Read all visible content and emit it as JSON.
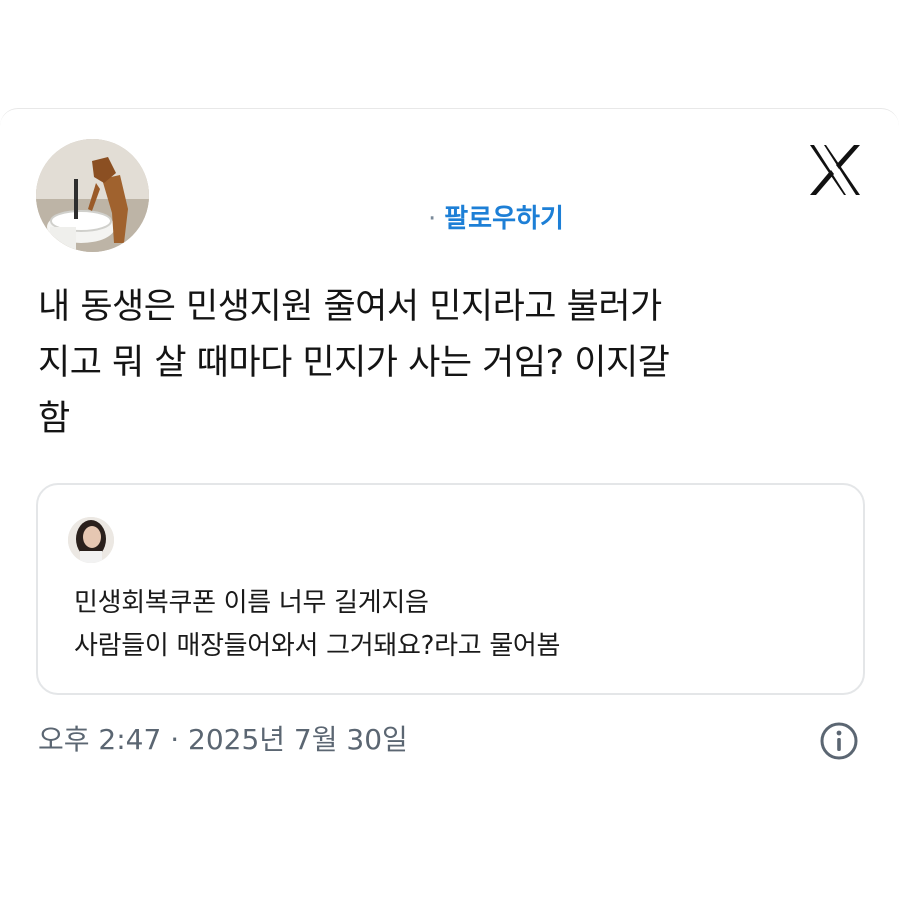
{
  "header": {
    "follow_dot": "·",
    "follow_label": "팔로우하기",
    "accent_color": "#1d7fd6"
  },
  "icons": {
    "close": "x-logo-icon",
    "info": "info-icon"
  },
  "tweet": {
    "line1": "내 동생은 민생지원 줄여서 민지라고 불러가",
    "line2": "지고 뭐 살 때마다 민지가 사는 거임? 이지갈",
    "line3": "함"
  },
  "quote": {
    "line1": "민생회복쿠폰 이름 너무 길게지음",
    "line2": "사람들이 매장들어와서 그거돼요?라고 물어봄"
  },
  "meta": {
    "timestamp": "오후 2:47 · 2025년 7월 30일"
  }
}
